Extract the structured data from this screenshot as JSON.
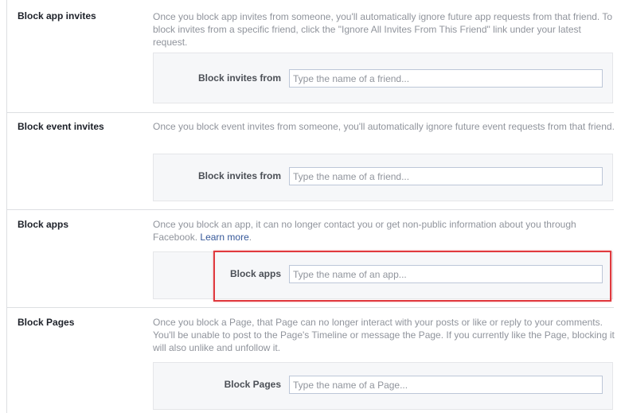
{
  "sections": [
    {
      "title": "Block app invites",
      "description": "Once you block app invites from someone, you'll automatically ignore future app requests from that friend. To block invites from a specific friend, click the \"Ignore All Invites From This Friend\" link under your latest request.",
      "field_label": "Block invites from",
      "placeholder": "Type the name of a friend..."
    },
    {
      "title": "Block event invites",
      "description": "Once you block event invites from someone, you'll automatically ignore future event requests from that friend.",
      "field_label": "Block invites from",
      "placeholder": "Type the name of a friend..."
    },
    {
      "title": "Block apps",
      "description": "Once you block an app, it can no longer contact you or get non-public information about you through Facebook.",
      "description_link": "Learn more",
      "description_end": ".",
      "field_label": "Block apps",
      "placeholder": "Type the name of an app..."
    },
    {
      "title": "Block Pages",
      "description": "Once you block a Page, that Page can no longer interact with your posts or like or reply to your comments. You'll be unable to post to the Page's Timeline or message the Page. If you currently like the Page, blocking it will also unlike and unfollow it.",
      "field_label": "Block Pages",
      "placeholder": "Type the name of a Page..."
    }
  ],
  "highlight_color": "#e0393e"
}
